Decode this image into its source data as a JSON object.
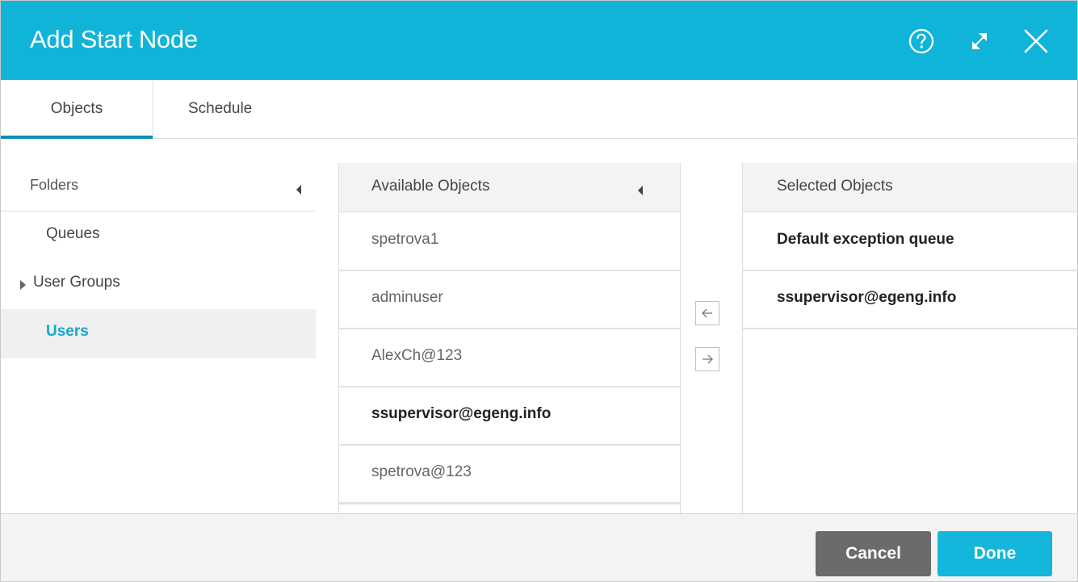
{
  "dialog": {
    "title": "Add Start Node",
    "header_icons": [
      "help-icon",
      "expand-icon",
      "close-icon"
    ],
    "accent_color": "#11b4d9"
  },
  "tabs": [
    {
      "label": "Objects",
      "active": true
    },
    {
      "label": "Schedule",
      "active": false
    }
  ],
  "folders": {
    "title": "Folders",
    "items": [
      {
        "label": "Queues",
        "selected": false
      },
      {
        "label": "User Groups",
        "selected": false,
        "expandable": true
      },
      {
        "label": "Users",
        "selected": true
      }
    ]
  },
  "available": {
    "title": "Available Objects",
    "items": [
      {
        "label": "spetrova1",
        "selected": false
      },
      {
        "label": "adminuser",
        "selected": false
      },
      {
        "label": "AlexCh@123",
        "selected": false
      },
      {
        "label": "ssupervisor@egeng.info",
        "selected": true
      },
      {
        "label": "spetrova@123",
        "selected": false
      }
    ]
  },
  "move_buttons": {
    "left_icon": "arrow-left-icon",
    "right_icon": "arrow-right-icon"
  },
  "selected": {
    "title": "Selected Objects",
    "items": [
      {
        "label": "Default exception queue"
      },
      {
        "label": "ssupervisor@egeng.info"
      }
    ]
  },
  "footer": {
    "cancel_label": "Cancel",
    "done_label": "Done",
    "cancel_color": "#6b6b6b",
    "done_color": "#14b6dc"
  }
}
